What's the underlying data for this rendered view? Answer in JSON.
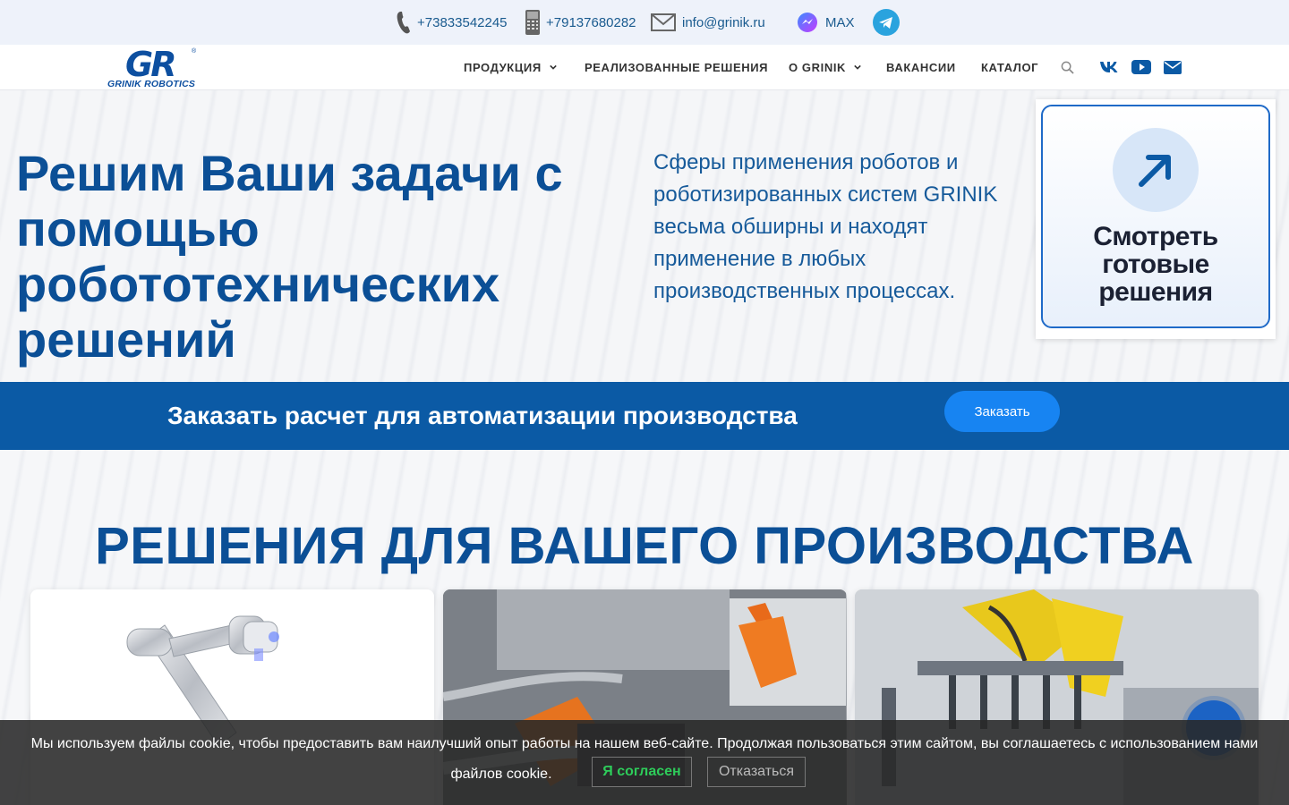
{
  "topbar": {
    "phone1": "+73833542245",
    "phone2": "+79137680282",
    "email": "info@grinik.ru",
    "max_label": "MAX",
    "icons": [
      "phone-icon",
      "mobile-phone-icon",
      "mail-icon",
      "max-messenger-icon",
      "telegram-icon"
    ]
  },
  "header": {
    "logo_mark": "GR",
    "logo_reg": "®",
    "logo_text": "GRINIK ROBOTICS",
    "nav": [
      {
        "label": "ПРОДУКЦИЯ",
        "dropdown": true
      },
      {
        "label": "РЕАЛИЗОВАННЫЕ РЕШЕНИЯ",
        "dropdown": false
      },
      {
        "label": "О GRINIK",
        "dropdown": true
      },
      {
        "label": "ВАКАНСИИ",
        "dropdown": false
      },
      {
        "label": "КАТАЛОГ",
        "dropdown": false
      }
    ],
    "icons": [
      "search-icon",
      "vk-icon",
      "youtube-icon",
      "email-icon"
    ]
  },
  "hero": {
    "title": "Решим Ваши задачи с помощью робототехнических решений",
    "lead": "Сферы применения роботов и роботизированных систем GRINIK весьма обширны и находят применение в любых производственных процессах.",
    "promo_text": "Смотреть готовые решения"
  },
  "cta": {
    "text": "Заказать расчет для автоматизации производства",
    "button": "Заказать"
  },
  "solutions": {
    "title": "РЕШЕНИЯ ДЛЯ ВАШЕГО ПРОИЗВОДСТВА"
  },
  "cookie": {
    "message_line1": "Мы используем файлы cookie, чтобы предоставить вам наилучший опыт работы на нашем веб-сайте. Продолжая пользоваться этим сайтом, вы соглашаетесь с использованием нами",
    "message_line2": "файлов cookie.",
    "accept": "Я согласен",
    "decline": "Отказаться"
  },
  "colors": {
    "brand_blue": "#0b4f96",
    "cta_band": "#0b5aa5",
    "cta_button": "#1784f2",
    "link": "#1a5b8f",
    "accept_green": "#2ecc5a"
  }
}
